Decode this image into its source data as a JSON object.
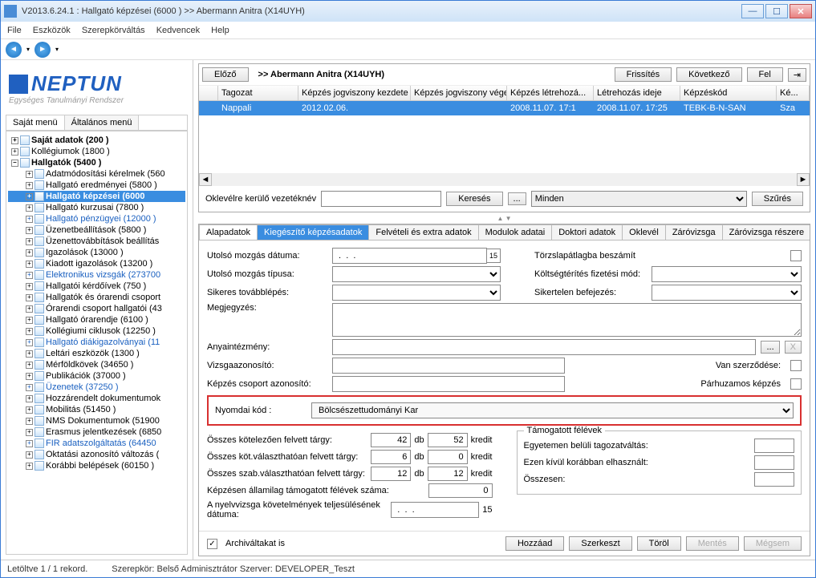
{
  "window": {
    "title": "V2013.6.24.1 : Hallgató képzései (6000 )  >> Abermann Anitra (X14UYH)"
  },
  "menubar": [
    "File",
    "Eszközök",
    "Szerepkörváltás",
    "Kedvencek",
    "Help"
  ],
  "topbar": {
    "prev": "Előző",
    "breadcrumb": ">> Abermann Anitra (X14UYH)",
    "refresh": "Frissítés",
    "next": "Következő",
    "up": "Fel"
  },
  "grid": {
    "headers": [
      "",
      "Tagozat",
      "Képzés jogviszony kezdete",
      "Képzés jogviszony vége",
      "Képzés létrehozá...",
      "Létrehozás ideje",
      "Képzéskód",
      "Ké..."
    ],
    "row": [
      "",
      "Nappali",
      "2012.02.06.",
      "",
      "2008.11.07. 17:1",
      "2008.11.07. 17:25",
      "TEBK-B-N-SAN",
      "Sza"
    ]
  },
  "search": {
    "label": "Oklevélre kerülő vezetéknév",
    "btn": "Keresés",
    "dots": "...",
    "filterSel": "Minden",
    "filterBtn": "Szűrés"
  },
  "sidebar": {
    "tabs": {
      "own": "Saját menü",
      "general": "Általános menü"
    },
    "logoTop": "NEPTUN",
    "logoSub": "Egységes Tanulmányi Rendszer",
    "tree": {
      "sajat": "Saját adatok (200  )",
      "koll": "Kollégiumok (1800  )",
      "hallg": "Hallgatók (5400  )",
      "items": [
        "Adatmódosítási kérelmek (560",
        "Hallgató eredményei (5800  )",
        "Hallgató képzései (6000",
        "Hallgató kurzusai (7800  )",
        "Hallgató pénzügyei (12000  )",
        "Üzenetbeállítások (5800  )",
        "Üzenettovábbítások beállítás",
        "Igazolások (13000  )",
        "Kiadott igazolások (13200  )",
        "Elektronikus vizsgák (273700",
        "Hallgatói kérdőívek (750  )",
        "Hallgatók és órarendi csoport",
        "Órarendi csoport hallgatói (43",
        "Hallgató órarendje (6100  )",
        "Kollégiumi ciklusok (12250  )",
        "Hallgató diákigazolványai (11",
        "Leltári eszközök (1300  )",
        "Mérföldkövek (34650  )",
        "Publikációk (37000  )",
        "Üzenetek (37250  )",
        "Hozzárendelt dokumentumok",
        "Mobilitás (51450  )",
        "NMS Dokumentumok (51900",
        "Erasmus jelentkezések (6850",
        "FIR adatszolgáltatás (64450",
        "Oktatási azonosító változás (",
        "Korábbi belépések (60150  )"
      ]
    }
  },
  "blueIdx": [
    4,
    9,
    15,
    19,
    24
  ],
  "tabs": [
    "Alapadatok",
    "Kiegészítő képzésadatok",
    "Felvételi és extra adatok",
    "Modulok adatai",
    "Doktori adatok",
    "Oklevél",
    "Záróvizsga",
    "Záróvizsga részere"
  ],
  "form": {
    "lastMoveDate": "Utolsó mozgás dátuma:",
    "lastMoveType": "Utolsó mozgás típusa:",
    "fwdSuccess": "Sikeres továbblépés:",
    "note": "Megjegyzés:",
    "parent": "Anyaintézmény:",
    "examId": "Vizsgaazonosító:",
    "groupId": "Képzés csoport azonosító:",
    "printCode": "Nyomdai kód :",
    "printCodeVal": "Bölcsészettudományi Kar",
    "torzs": "Törzslapátlagba beszámít",
    "fee": "Költségtérítés fizetési mód:",
    "fail": "Sikertelen befejezés:",
    "hasContract": "Van szerződése:",
    "parallel": "Párhuzamos képzés",
    "dotsBtn": "...",
    "xBtn": "X"
  },
  "nums": {
    "l1": "Összes kötelezően felvett tárgy:",
    "l2": "Összes köt.választhatóan felvett tárgy:",
    "l3": "Összes szab.választhatóan felvett tárgy:",
    "l4": "Képzésen államilag támogatott félévek száma:",
    "l5": "A nyelvvizsga követelmények teljesülésének dátuma:",
    "db": "db",
    "kr": "kredit",
    "v1a": "42",
    "v1b": "52",
    "v2a": "6",
    "v2b": "0",
    "v3a": "12",
    "v3b": "12",
    "v4": "0"
  },
  "group": {
    "legend": "Támogatott félévek",
    "r1": "Egyetemen belüli tagozatváltás:",
    "r2": "Ezen kívül korábban elhasznált:",
    "r3": "Összesen:"
  },
  "bottom": {
    "archCheck": "Archiváltakat is",
    "add": "Hozzáad",
    "edit": "Szerkeszt",
    "del": "Töröl",
    "save": "Mentés",
    "cancel": "Mégsem"
  },
  "status": {
    "left": "Letöltve 1 / 1 rekord.",
    "mid": "Szerepkör: Belső Adminisztrátor    Szerver: DEVELOPER_Teszt"
  }
}
